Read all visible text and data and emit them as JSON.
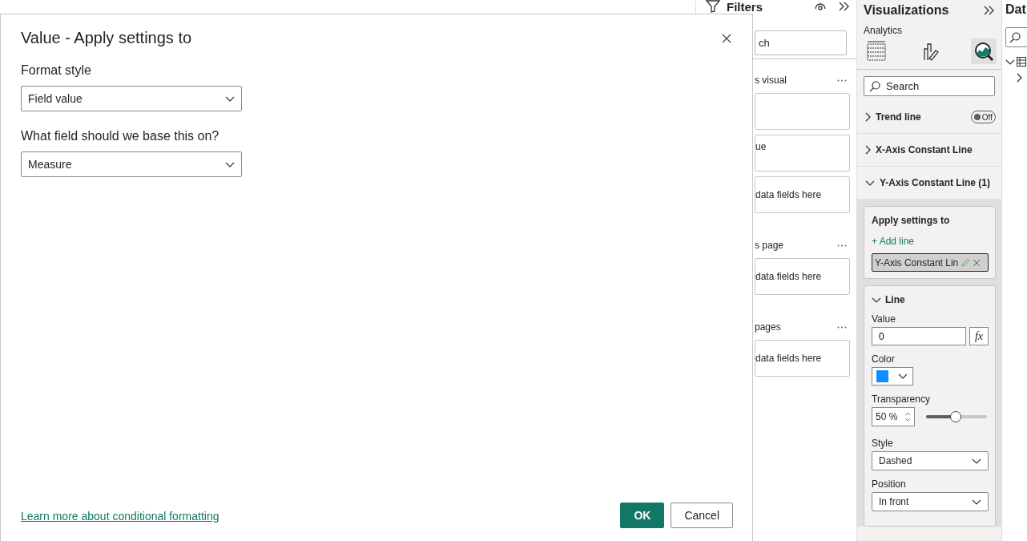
{
  "dialog": {
    "title": "Value - Apply settings to",
    "fields": [
      {
        "label": "Format style",
        "value": "Field value"
      },
      {
        "label": "What field should we base this on?",
        "value": "Measure"
      }
    ],
    "link": "Learn more about conditional formatting",
    "buttons": [
      {
        "label": "OK",
        "kind": "primary"
      },
      {
        "label": "Cancel",
        "kind": "secondary"
      }
    ]
  },
  "filters": {
    "title": "Filters",
    "search": {
      "placeholder": "ch"
    },
    "sections": [
      {
        "heading": "s visual",
        "wells": [
          {
            "kind": "empty"
          },
          {
            "kind": "field",
            "text": "ue"
          },
          {
            "kind": "drop",
            "text": "data fields here"
          }
        ]
      },
      {
        "heading": "s page",
        "wells": [
          {
            "kind": "drop",
            "text": "data fields here"
          }
        ]
      },
      {
        "heading": "pages",
        "wells": [
          {
            "kind": "drop",
            "text": "data fields here"
          }
        ]
      }
    ]
  },
  "visualizations": {
    "title": "Visualizations",
    "subtitle": "Analytics",
    "tabs": [
      {
        "kind": "build",
        "selected": false
      },
      {
        "kind": "format",
        "selected": false
      },
      {
        "kind": "analytics",
        "selected": true
      }
    ],
    "search": {
      "placeholder": "Search"
    },
    "sections": [
      {
        "label": "Trend line",
        "expanded": false,
        "toggle": {
          "label": "Off",
          "on": false
        }
      },
      {
        "label": "X-Axis Constant Line",
        "expanded": false
      },
      {
        "label": "Y-Axis Constant Line (1)",
        "expanded": true
      }
    ],
    "apply": {
      "title": "Apply settings to",
      "add": "+ Add line",
      "chip": "Y-Axis Constant Lin"
    },
    "line": {
      "heading": "Line",
      "expanded": true,
      "value": {
        "label": "Value",
        "value": "0",
        "fx": "fx"
      },
      "color": {
        "label": "Color",
        "color": "#118dff"
      },
      "transparency": {
        "label": "Transparency",
        "value": "50 %",
        "level": 0.49
      },
      "style": {
        "label": "Style",
        "value": "Dashed"
      },
      "position": {
        "label": "Position",
        "value": "In front"
      }
    }
  },
  "data": {
    "title": "Dat"
  }
}
